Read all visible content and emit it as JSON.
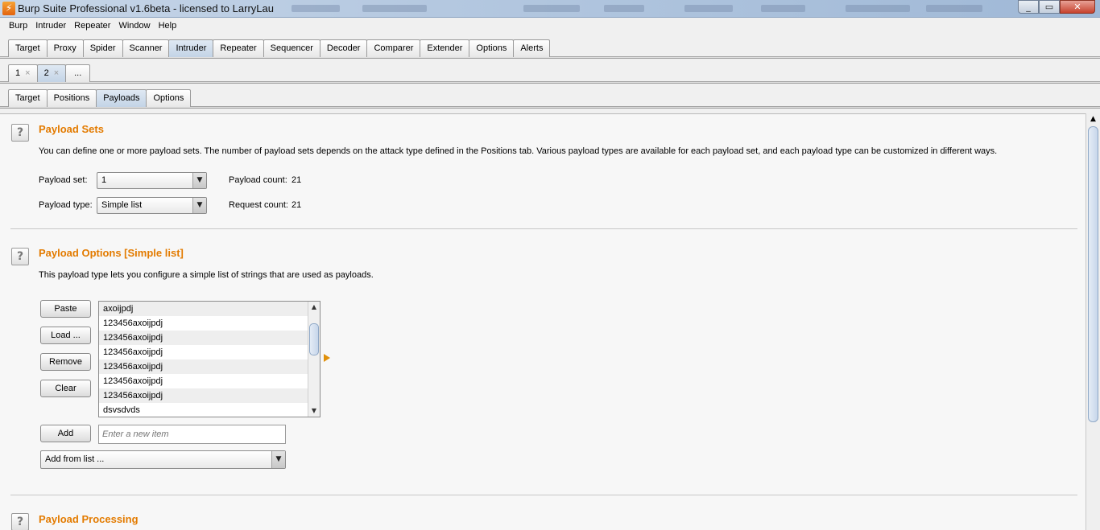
{
  "window": {
    "title": "Burp Suite Professional v1.6beta - licensed to LarryLau",
    "icon": "burp-lightning-icon",
    "minimize": "_",
    "maximize": "▭",
    "close": "✕"
  },
  "menu": [
    "Burp",
    "Intruder",
    "Repeater",
    "Window",
    "Help"
  ],
  "main_tabs": [
    "Target",
    "Proxy",
    "Spider",
    "Scanner",
    "Intruder",
    "Repeater",
    "Sequencer",
    "Decoder",
    "Comparer",
    "Extender",
    "Options",
    "Alerts"
  ],
  "main_tab_active": "Intruder",
  "attack_tabs": [
    {
      "label": "1",
      "close": "×"
    },
    {
      "label": "2",
      "close": "×"
    },
    {
      "label": "..."
    }
  ],
  "attack_tab_active": "2",
  "sub_tabs": [
    "Target",
    "Positions",
    "Payloads",
    "Options"
  ],
  "sub_tab_active": "Payloads",
  "payload_sets": {
    "help": "?",
    "title": "Payload Sets",
    "description": "You can define one or more payload sets. The number of payload sets depends on the attack type defined in the Positions tab. Various payload types are available for each payload set, and each payload type can be customized in different ways.",
    "set_label": "Payload set:",
    "set_value": "1",
    "type_label": "Payload type:",
    "type_value": "Simple list",
    "payload_count_label": "Payload count:",
    "payload_count": "21",
    "request_count_label": "Request count:",
    "request_count": "21"
  },
  "payload_options": {
    "help": "?",
    "title": "Payload Options [Simple list]",
    "description": "This payload type lets you configure a simple list of strings that are used as payloads.",
    "buttons": {
      "paste": "Paste",
      "load": "Load ...",
      "remove": "Remove",
      "clear": "Clear",
      "add": "Add"
    },
    "items": [
      "axoijpdj",
      "123456axoijpdj",
      "123456axoijpdj",
      "123456axoijpdj",
      "123456axoijpdj",
      "123456axoijpdj",
      "123456axoijpdj",
      "dsvsdvds"
    ],
    "new_item_placeholder": "Enter a new item",
    "add_from_list": "Add from list ..."
  },
  "payload_processing": {
    "help": "?",
    "title": "Payload Processing"
  },
  "colors": {
    "section_title": "#e37b00",
    "active_tab": "#c3d4e6"
  }
}
